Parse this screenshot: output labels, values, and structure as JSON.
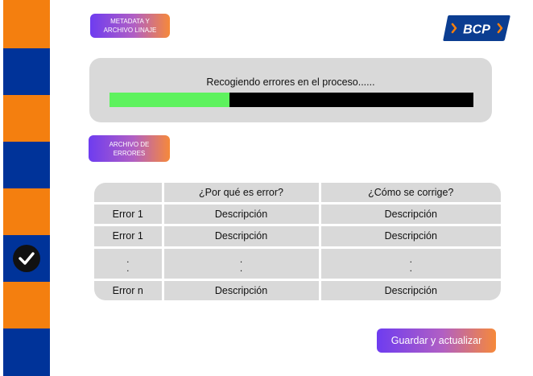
{
  "colors": {
    "rail_orange": "#f47f0f",
    "rail_blue": "#003399",
    "progress_fill": "#5ef25e",
    "panel_gray": "#d9d9d9",
    "gradient_start": "#6e3cf0",
    "gradient_end": "#f6893a"
  },
  "stepper": {
    "segments": [
      "orange",
      "blue",
      "orange",
      "blue",
      "orange",
      "blue",
      "orange",
      "blue"
    ],
    "completed_step_icon": "check-circle-icon"
  },
  "header": {
    "metadata_button": [
      "METADATA Y",
      "ARCHIVO LINAJE"
    ],
    "logo_text": "BCP"
  },
  "progress": {
    "label": "Recogiendo errores en el proceso......",
    "fraction": 0.33
  },
  "errors": {
    "button": [
      "ARCHIVO DE",
      "ERRORES"
    ],
    "columns": [
      "",
      "¿Por qué es error?",
      "¿Cómo se corrige?"
    ],
    "rows": [
      [
        "Error 1",
        "Descripción",
        "Descripción"
      ],
      [
        "Error 1",
        "Descripción",
        "Descripción"
      ],
      [
        ".\n.",
        ".\n.",
        ".\n."
      ],
      [
        "Error n",
        "Descripción",
        "Descripción"
      ]
    ]
  },
  "actions": {
    "save_label": "Guardar y actualizar"
  }
}
